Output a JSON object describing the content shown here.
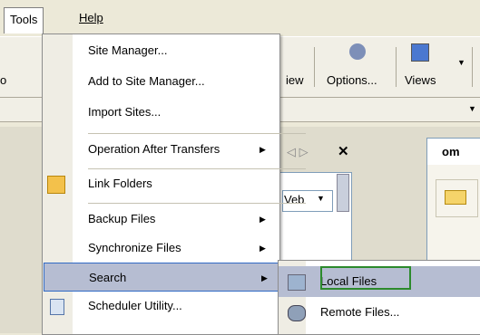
{
  "menubar": {
    "tools": "Tools",
    "help": "Help"
  },
  "toolbar": {
    "partial_view": "iew",
    "options": "Options...",
    "views": "Views",
    "left_cut": "o"
  },
  "panel": {
    "tab_partial": "om",
    "web_combo": "Veb"
  },
  "tools_menu": {
    "items": [
      {
        "label": "Site Manager...",
        "arrow": ""
      },
      {
        "label": "Add to Site Manager...",
        "arrow": ""
      },
      {
        "label": "Import Sites...",
        "arrow": ""
      },
      {
        "label": "Operation After Transfers",
        "arrow": "▶"
      },
      {
        "label": "Link Folders",
        "arrow": ""
      },
      {
        "label": "Backup Files",
        "arrow": "▶"
      },
      {
        "label": "Synchronize Files",
        "arrow": "▶"
      },
      {
        "label": "Search",
        "arrow": "▶"
      },
      {
        "label": "Scheduler Utility...",
        "arrow": ""
      }
    ]
  },
  "search_submenu": {
    "items": [
      {
        "label": "Local Files"
      },
      {
        "label": "Remote Files..."
      }
    ]
  },
  "colors": {
    "highlight": "#b6bdd2",
    "focus": "#2c8a2c",
    "menu_border": "#8d8d8d"
  }
}
